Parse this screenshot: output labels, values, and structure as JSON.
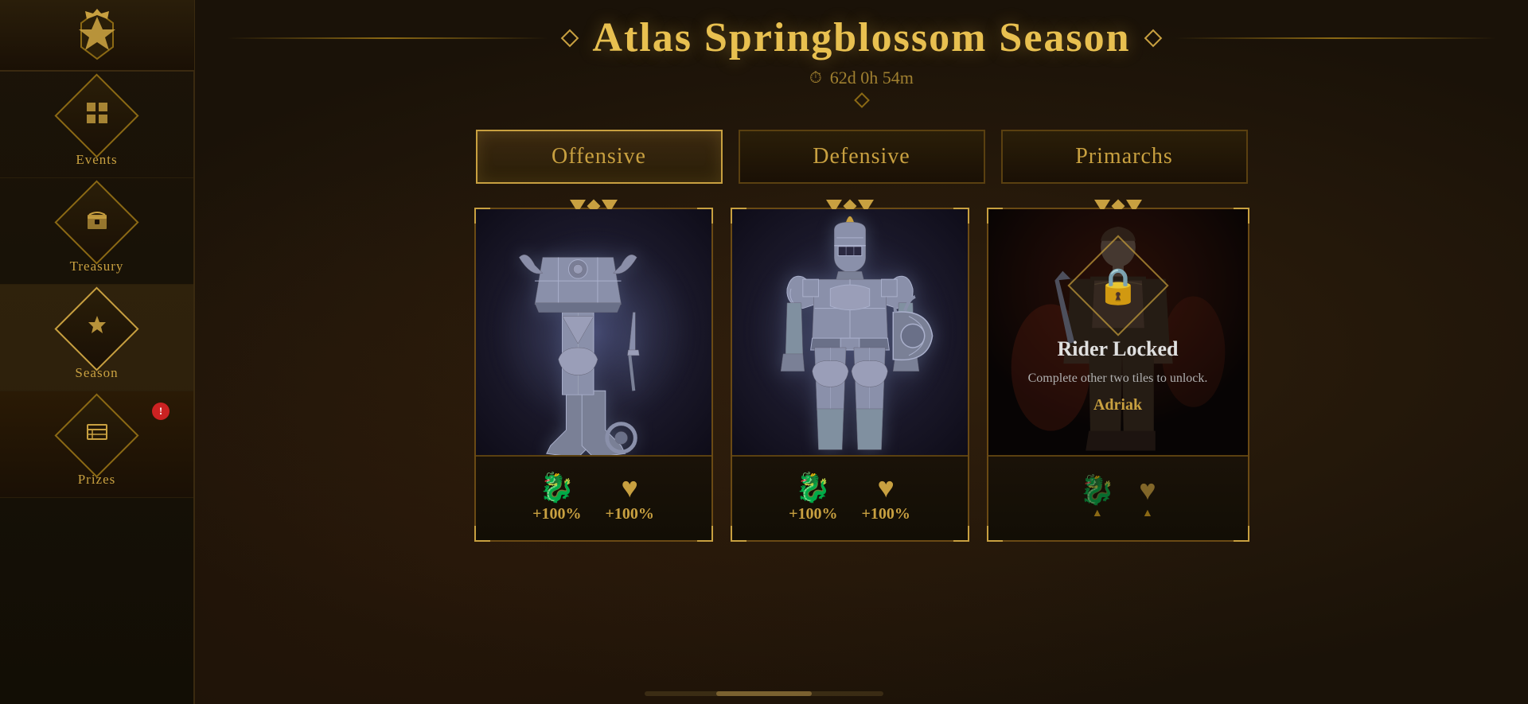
{
  "sidebar": {
    "logo_alt": "Game Logo",
    "items": [
      {
        "id": "events",
        "label": "Events",
        "icon": "grid-icon",
        "active": false,
        "notification": null
      },
      {
        "id": "treasury",
        "label": "Treasury",
        "icon": "chest-icon",
        "active": false,
        "notification": null
      },
      {
        "id": "season",
        "label": "Season",
        "icon": "star-icon",
        "active": true,
        "notification": null
      },
      {
        "id": "prizes",
        "label": "Prizes",
        "icon": "list-icon",
        "active": false,
        "notification": 1
      }
    ]
  },
  "header": {
    "title": "Atlas Springblossom Season",
    "timer_label": "62d 0h 54m"
  },
  "tabs": [
    {
      "id": "offensive",
      "label": "Offensive",
      "active": true
    },
    {
      "id": "defensive",
      "label": "Defensive",
      "active": false
    },
    {
      "id": "primarchs",
      "label": "Primarchs",
      "active": false
    }
  ],
  "cards": [
    {
      "id": "card1",
      "locked": false,
      "image_type": "armor_legs",
      "bonus_icons": [
        {
          "type": "dragon",
          "value": "+100%",
          "show_arrow": false
        },
        {
          "type": "heart",
          "value": "+100%",
          "show_arrow": false
        }
      ]
    },
    {
      "id": "card2",
      "locked": false,
      "image_type": "armor_body",
      "bonus_icons": [
        {
          "type": "dragon",
          "value": "+100%",
          "show_arrow": false
        },
        {
          "type": "heart",
          "value": "+100%",
          "show_arrow": false
        }
      ]
    },
    {
      "id": "card3",
      "locked": true,
      "image_type": "character",
      "locked_title": "Rider Locked",
      "locked_desc": "Complete other two tiles to unlock.",
      "locked_name": "Adriak",
      "bonus_icons": [
        {
          "type": "dragon",
          "value": "",
          "show_arrow": true
        },
        {
          "type": "heart",
          "value": "",
          "show_arrow": true
        }
      ]
    }
  ],
  "scrollbar": {
    "visible": true
  }
}
